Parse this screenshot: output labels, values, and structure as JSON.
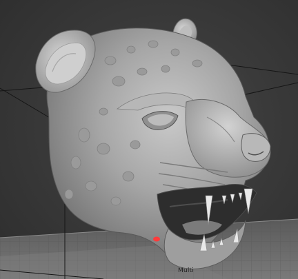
{
  "viewport": {
    "name": "3d-viewport"
  },
  "scene": {
    "object_name": "jaguar-head-model",
    "plate_label": "Multi"
  },
  "colors": {
    "background": "#3a3a3a",
    "grid_line": "#1a1a1a",
    "bed_plate": "#6b6b6b",
    "model_base": "#a9a9a9",
    "model_shadow": "#5d5d5d",
    "mouth_interior": "#2a2a2a",
    "tooth": "#e8e8e8",
    "marker": "#ff3b3b"
  }
}
